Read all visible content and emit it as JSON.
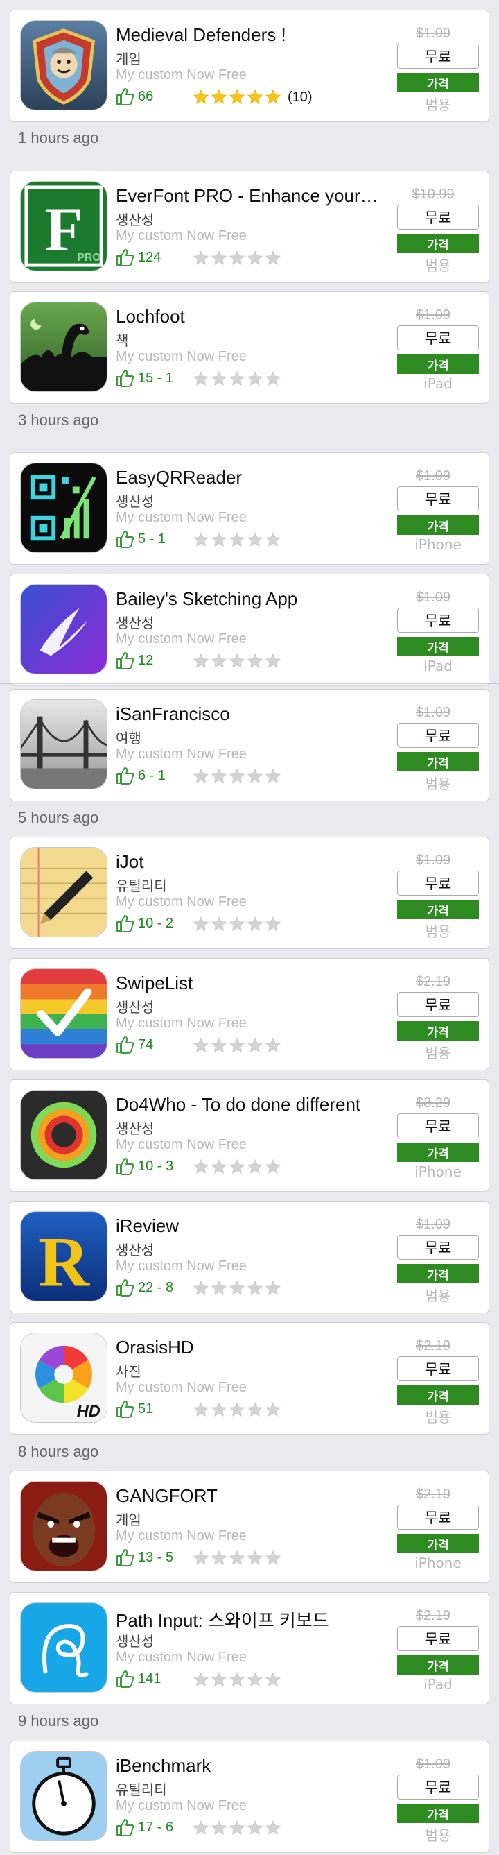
{
  "labels": {
    "free": "무료",
    "price": "가격",
    "subtitle": "My custom Now Free"
  },
  "colors": {
    "accent_green": "#2e8b22",
    "star_gold": "#f5c518",
    "like_green": "#1f8a1f"
  },
  "items": [
    {
      "title": "Medieval Defenders !",
      "category": "게임",
      "old_price": "$1.09",
      "likes": "66",
      "rated": true,
      "rating_count": "(10)",
      "device": "범용",
      "icon": "medieval-shield-icon"
    },
    {
      "title": "EverFont PRO - Enhance your…",
      "category": "생산성",
      "old_price": "$10.99",
      "likes": "124",
      "rated": false,
      "rating_count": "",
      "device": "범용",
      "icon": "everfont-f-icon"
    },
    {
      "title": "Lochfoot",
      "category": "책",
      "old_price": "$1.09",
      "likes": "15 - 1",
      "rated": false,
      "rating_count": "",
      "device": "iPad",
      "icon": "lochfoot-monster-icon"
    },
    {
      "title": "EasyQRReader",
      "category": "생산성",
      "old_price": "$1.09",
      "likes": "5 - 1",
      "rated": false,
      "rating_count": "",
      "device": "iPhone",
      "icon": "qr-code-icon"
    },
    {
      "title": "Bailey's Sketching App",
      "category": "생산성",
      "old_price": "$1.09",
      "likes": "12",
      "rated": false,
      "rating_count": "",
      "device": "iPad",
      "icon": "sketch-brush-icon"
    },
    {
      "title": "iSanFrancisco",
      "category": "여행",
      "old_price": "$1.09",
      "likes": "6 - 1",
      "rated": false,
      "rating_count": "",
      "device": "범용",
      "icon": "golden-gate-bridge-icon"
    },
    {
      "title": "iJot",
      "category": "유틸리티",
      "old_price": "$1.09",
      "likes": "10 - 2",
      "rated": false,
      "rating_count": "",
      "device": "범용",
      "icon": "notepad-pen-icon"
    },
    {
      "title": "SwipeList",
      "category": "생산성",
      "old_price": "$2.19",
      "likes": "74",
      "rated": false,
      "rating_count": "",
      "device": "범용",
      "icon": "rainbow-checkmark-icon"
    },
    {
      "title": "Do4Who - To do done different",
      "category": "생산성",
      "old_price": "$3.29",
      "likes": "10 - 3",
      "rated": false,
      "rating_count": "",
      "device": "iPhone",
      "icon": "target-rings-icon"
    },
    {
      "title": "iReview",
      "category": "생산성",
      "old_price": "$1.09",
      "likes": "22 - 8",
      "rated": false,
      "rating_count": "",
      "device": "범용",
      "icon": "letter-r-icon"
    },
    {
      "title": "OrasisHD",
      "category": "사진",
      "old_price": "$2.19",
      "likes": "51",
      "rated": false,
      "rating_count": "",
      "device": "범용",
      "icon": "color-wheel-icon"
    },
    {
      "title": "GANGFORT",
      "category": "게임",
      "old_price": "$2.19",
      "likes": "13 - 5",
      "rated": false,
      "rating_count": "",
      "device": "iPhone",
      "icon": "angry-face-icon"
    },
    {
      "title": "Path Input: 스와이프 키보드",
      "category": "생산성",
      "old_price": "$2.19",
      "likes": "141",
      "rated": false,
      "rating_count": "",
      "device": "iPad",
      "icon": "swipe-path-icon"
    },
    {
      "title": "iBenchmark",
      "category": "유틸리티",
      "old_price": "$1.09",
      "likes": "17 - 6",
      "rated": false,
      "rating_count": "",
      "device": "범용",
      "icon": "stopwatch-icon"
    }
  ],
  "time_headers": [
    "1 hours ago",
    "3 hours ago",
    "5 hours ago",
    "8 hours ago",
    "9 hours ago"
  ]
}
